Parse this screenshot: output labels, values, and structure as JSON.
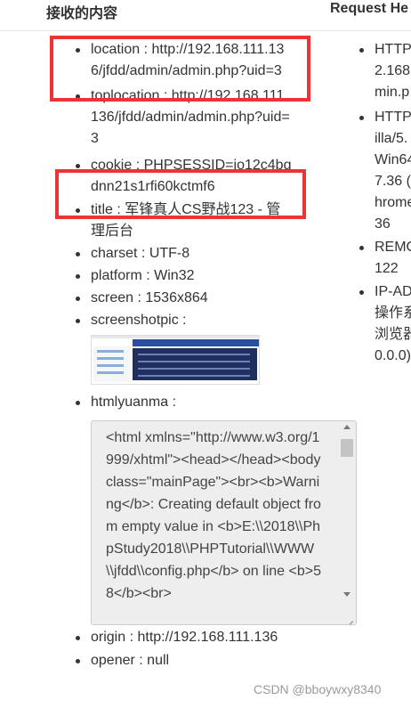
{
  "header": {
    "left_title": "接收的内容",
    "right_title": "Request He"
  },
  "left_items": [
    {
      "key": "location",
      "value": "http://192.168.111.136/jfdd/admin/admin.php?uid=3"
    },
    {
      "key": "toplocation",
      "value": "http://192.168.111.136/jfdd/admin/admin.php?uid=3"
    },
    {
      "key": "cookie",
      "value": "PHPSESSID=jo12c4bqdnn21s1rfi60kctmf6"
    },
    {
      "key": "title",
      "value": "军锋真人CS野战123 - 管理后台"
    },
    {
      "key": "charset",
      "value": "UTF-8"
    },
    {
      "key": "platform",
      "value": "Win32"
    },
    {
      "key": "screen",
      "value": "1536x864"
    },
    {
      "key": "screenshotpic",
      "value": ""
    },
    {
      "key": "htmlyuanma",
      "value": ""
    },
    {
      "key": "origin",
      "value": "http://192.168.111.136"
    },
    {
      "key": "opener",
      "value": "null"
    }
  ],
  "htmlyuanma_text": "<html xmlns=\"http://www.w3.org/1999/xhtml\"><head></head><body class=\"mainPage\"><br><b>Warning</b>:  Creating default object from empty value in <b>E:\\\\2018\\\\PhpStudy2018\\\\PHPTutorial\\\\WWW\\\\jfdd\\\\config.php</b> on line <b>58</b><br>",
  "right_lines": [
    [
      "HTTP",
      "2.168",
      "min.p"
    ],
    [
      "HTTP",
      "illa/5.",
      "Win64",
      "7.36 (",
      "hrome",
      "36"
    ],
    [
      "REMO",
      "122"
    ],
    [
      "IP-AD",
      "操作系",
      "浏览器",
      "0.0.0)"
    ]
  ],
  "watermark": "CSDN @bboywxy8340",
  "colors": {
    "highlight": "#ee3333"
  }
}
